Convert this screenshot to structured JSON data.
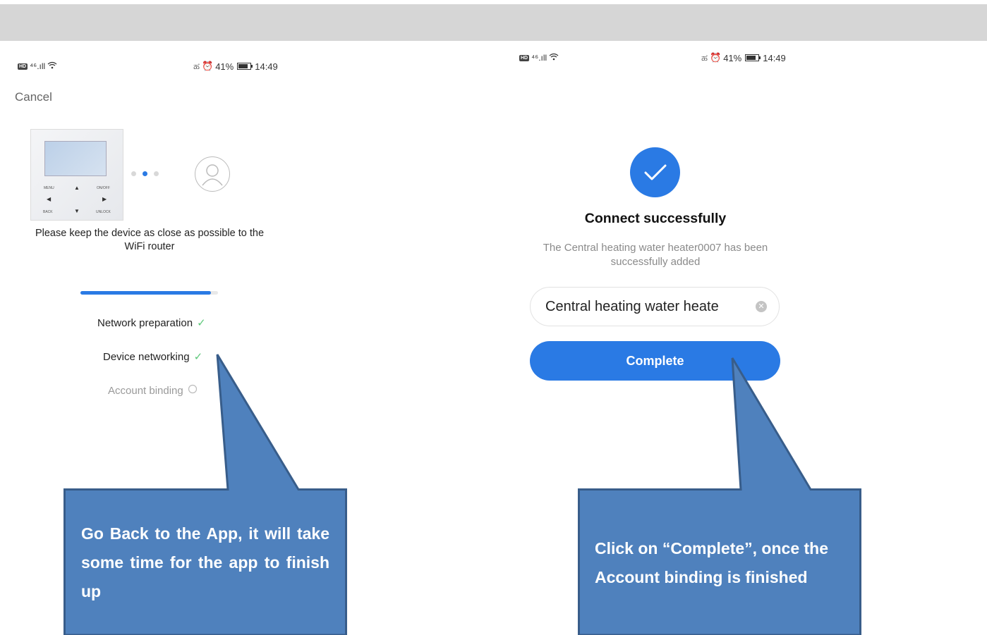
{
  "left_phone": {
    "status_left": "⁴⁶.ıll",
    "status_right": {
      "battery": "41%",
      "time": "14:49"
    },
    "cancel": "Cancel",
    "device_labels": {
      "menu": "MENU",
      "on_off": "ON/OFF",
      "back": "BACK",
      "unlock": "UNLOCK"
    },
    "instruction": "Please keep the device as close as possible to the WiFi router",
    "progress_fraction": 0.95,
    "steps": [
      {
        "label": "Network preparation",
        "done": true
      },
      {
        "label": "Device networking",
        "done": true
      },
      {
        "label": "Account binding",
        "done": false
      }
    ]
  },
  "right_phone": {
    "status_left": "⁴⁶.ıll",
    "status_right": {
      "battery": "41%",
      "time": "14:49"
    },
    "title": "Connect successfully",
    "description": "The Central heating water heater0007 has been successfully added",
    "device_name_value": "Central heating water heate",
    "complete_label": "Complete"
  },
  "callouts": {
    "left": "Go Back to the App, it will take some time for the app to finish up",
    "right": "Click on “Complete”, once the Account binding is finished"
  },
  "colors": {
    "accent": "#2a7ae4",
    "callout_fill": "#4f81bd",
    "callout_border": "#385d8a",
    "check": "#5cc87a"
  }
}
